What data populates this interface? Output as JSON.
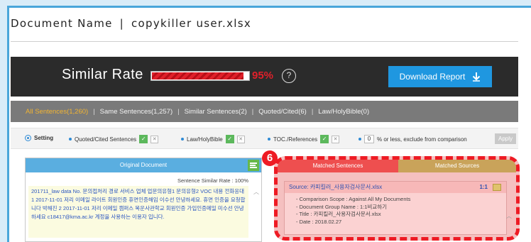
{
  "document": {
    "label": "Document Name",
    "separator": "|",
    "file_name": "copykiller user.xlsx"
  },
  "similar_rate": {
    "label": "Similar Rate",
    "value_text": "95%",
    "progress_fraction": 0.95,
    "help_symbol": "?",
    "download_label": "Download Report"
  },
  "filters": [
    {
      "label": "All Sentences(1,260)",
      "active": true
    },
    {
      "label": "Same Sentences(1,257)",
      "active": false
    },
    {
      "label": "Similar Sentences(2)",
      "active": false
    },
    {
      "label": "Quoted/Cited(6)",
      "active": false
    },
    {
      "label": "Law/HolyBible(0)",
      "active": false
    }
  ],
  "settings": {
    "setting_label": "Setting",
    "quoted_label": "Quoted/Cited Sentences",
    "law_label": "Law/HolyBible",
    "toc_label": "TOC./References",
    "percent_value": "0",
    "exclude_label": "% or less, exclude from comparison",
    "apply_label": "Apply"
  },
  "original": {
    "title": "Original Document",
    "similar_rate_line": "Sentence Similar Rate : 100%",
    "body": "201711_law data No. 문의접처리 경로 서비스 업체 업문의유형1 문의유형2 VOC 내용 전화응대 1 2017-11-01 저리 이메일 라이트 회원인증 휴면인증해임 이수선 안녕하세요. 휴면 인증을 요청합니다 박해진 2 2017-11-01 저리 이메일 캠퍼스 목운사관학교 회원인증 가입인증메일 미수선 안녕하세요 c18417@kma.ac.kr 계정을 사용하는 이용자 입니다."
  },
  "matched": {
    "marker": "6",
    "tab_sentences": "Matched Sentences",
    "tab_sources": "Matched Sources",
    "source_label": "Source: 카피킬러_사용자검사문서.xlsx",
    "ratio": "1:1",
    "details": [
      "- Comparison Scope : Against All My Documents",
      "- Document Group Name : 1:1비교하기",
      "- Title : 카피킬러_사용자검사문서.xlsx",
      "- Date : 2018.02.27"
    ]
  },
  "colors": {
    "accent_blue": "#1f97e0",
    "highlight_red": "#ee1b24",
    "active_filter": "#f2b432"
  }
}
